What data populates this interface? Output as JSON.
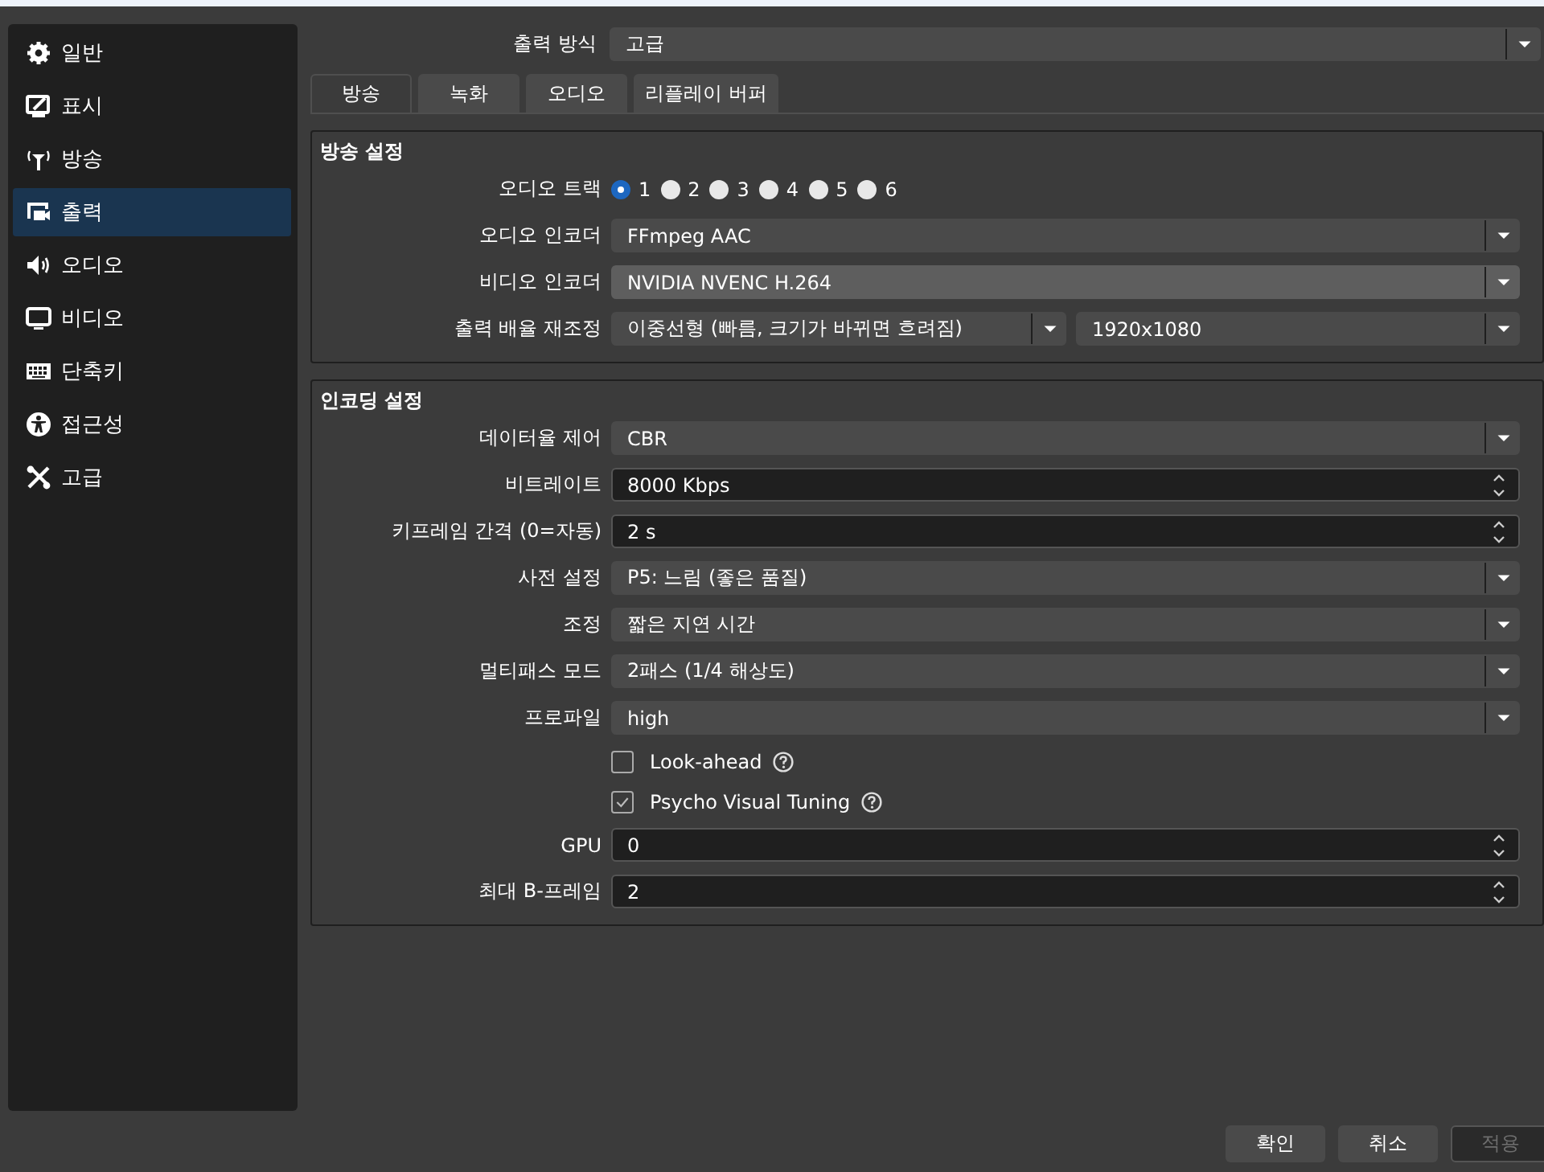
{
  "sidebar": {
    "items": [
      {
        "label": "일반",
        "selected": false
      },
      {
        "label": "표시",
        "selected": false
      },
      {
        "label": "방송",
        "selected": false
      },
      {
        "label": "출력",
        "selected": true
      },
      {
        "label": "오디오",
        "selected": false
      },
      {
        "label": "비디오",
        "selected": false
      },
      {
        "label": "단축키",
        "selected": false
      },
      {
        "label": "접근성",
        "selected": false
      },
      {
        "label": "고급",
        "selected": false
      }
    ]
  },
  "output_mode": {
    "label": "출력 방식",
    "value": "고급"
  },
  "tabs": [
    {
      "label": "방송",
      "selected": true
    },
    {
      "label": "녹화",
      "selected": false
    },
    {
      "label": "오디오",
      "selected": false
    },
    {
      "label": "리플레이 버퍼",
      "selected": false
    }
  ],
  "groups": [
    {
      "title": "방송 설정",
      "rows": [
        {
          "kind": "radios",
          "label": "오디오 트랙",
          "options": [
            {
              "label": "1",
              "selected": true
            },
            {
              "label": "2",
              "selected": false
            },
            {
              "label": "3",
              "selected": false
            },
            {
              "label": "4",
              "selected": false
            },
            {
              "label": "5",
              "selected": false
            },
            {
              "label": "6",
              "selected": false
            }
          ]
        },
        {
          "kind": "combo",
          "label": "오디오 인코더",
          "value": "FFmpeg AAC",
          "hovered": false
        },
        {
          "kind": "combo",
          "label": "비디오 인코더",
          "value": "NVIDIA NVENC H.264",
          "hovered": true
        },
        {
          "kind": "combo_pair",
          "label": "출력 배율 재조정",
          "values": [
            "이중선형 (빠름, 크기가 바뀌면 흐려짐)",
            "1920x1080"
          ]
        }
      ]
    },
    {
      "title": "인코딩 설정",
      "rows": [
        {
          "kind": "combo",
          "label": "데이터율 제어",
          "value": "CBR",
          "hovered": false
        },
        {
          "kind": "spin",
          "label": "비트레이트",
          "value": "8000 Kbps"
        },
        {
          "kind": "spin",
          "label": "키프레임 간격 (0=자동)",
          "value": "2 s"
        },
        {
          "kind": "combo",
          "label": "사전 설정",
          "value": "P5: 느림 (좋은 품질)",
          "hovered": false
        },
        {
          "kind": "combo",
          "label": "조정",
          "value": "짧은 지연 시간",
          "hovered": false
        },
        {
          "kind": "combo",
          "label": "멀티패스 모드",
          "value": "2패스 (1/4 해상도)",
          "hovered": false
        },
        {
          "kind": "combo",
          "label": "프로파일",
          "value": "high",
          "hovered": false
        },
        {
          "kind": "check",
          "label": "Look-ahead",
          "checked": false
        },
        {
          "kind": "check",
          "label": "Psycho Visual Tuning",
          "checked": true
        },
        {
          "kind": "spin",
          "label": "GPU",
          "value": "0"
        },
        {
          "kind": "spin",
          "label": "최대 B-프레임",
          "value": "2"
        }
      ]
    }
  ],
  "buttons": [
    {
      "label": "확인",
      "disabled": false
    },
    {
      "label": "취소",
      "disabled": false
    },
    {
      "label": "적용",
      "disabled": true
    }
  ]
}
